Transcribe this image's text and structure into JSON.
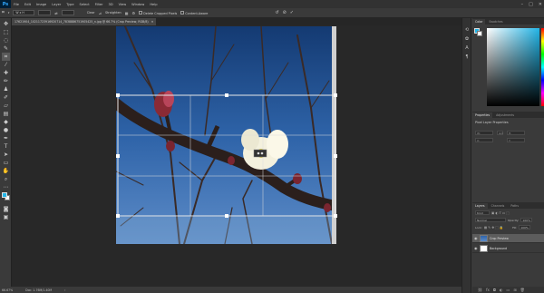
{
  "app": {
    "logo": "Ps"
  },
  "menu": [
    "File",
    "Edit",
    "Image",
    "Layer",
    "Type",
    "Select",
    "Filter",
    "3D",
    "View",
    "Window",
    "Help"
  ],
  "window_controls": [
    "–",
    "□",
    "✕"
  ],
  "options": {
    "ratio_field": "W x H",
    "clear_label": "Clear",
    "straighten_label": "Straighten",
    "delete_cropped_label": "Delete Cropped Pixels",
    "content_aware_label": "Content-Aware"
  },
  "document": {
    "tab_title": "17621904_10211723916920714_7838886751905425_n.jpg @ 66.7% (Crop Preview, RGB/8)",
    "close": "✕"
  },
  "status": {
    "zoom": "66.67%",
    "doc_size": "Doc: 1.76M/1.40M",
    "arrow": "›"
  },
  "panels": {
    "color_tabs": [
      "Color",
      "Swatches"
    ],
    "fg_color": "#23b5e7",
    "bg_color": "#ffffff",
    "properties_tabs": [
      "Properties",
      "Adjustments"
    ],
    "properties_title": "Pixel Layer Properties",
    "fields": [
      "W:",
      "H:",
      "X:",
      "Y:"
    ],
    "go_label": "GO",
    "layers_tabs": [
      "Layers",
      "Channels",
      "Paths"
    ],
    "kind_label": "Kind",
    "blend_mode": "Normal",
    "opacity_label": "Opacity:",
    "opacity_value": "100%",
    "lock_label": "Lock:",
    "fill_label": "Fill:",
    "fill_value": "100%",
    "layers": [
      {
        "name": "Crop Preview",
        "active": true
      },
      {
        "name": "Background",
        "active": false
      }
    ]
  }
}
